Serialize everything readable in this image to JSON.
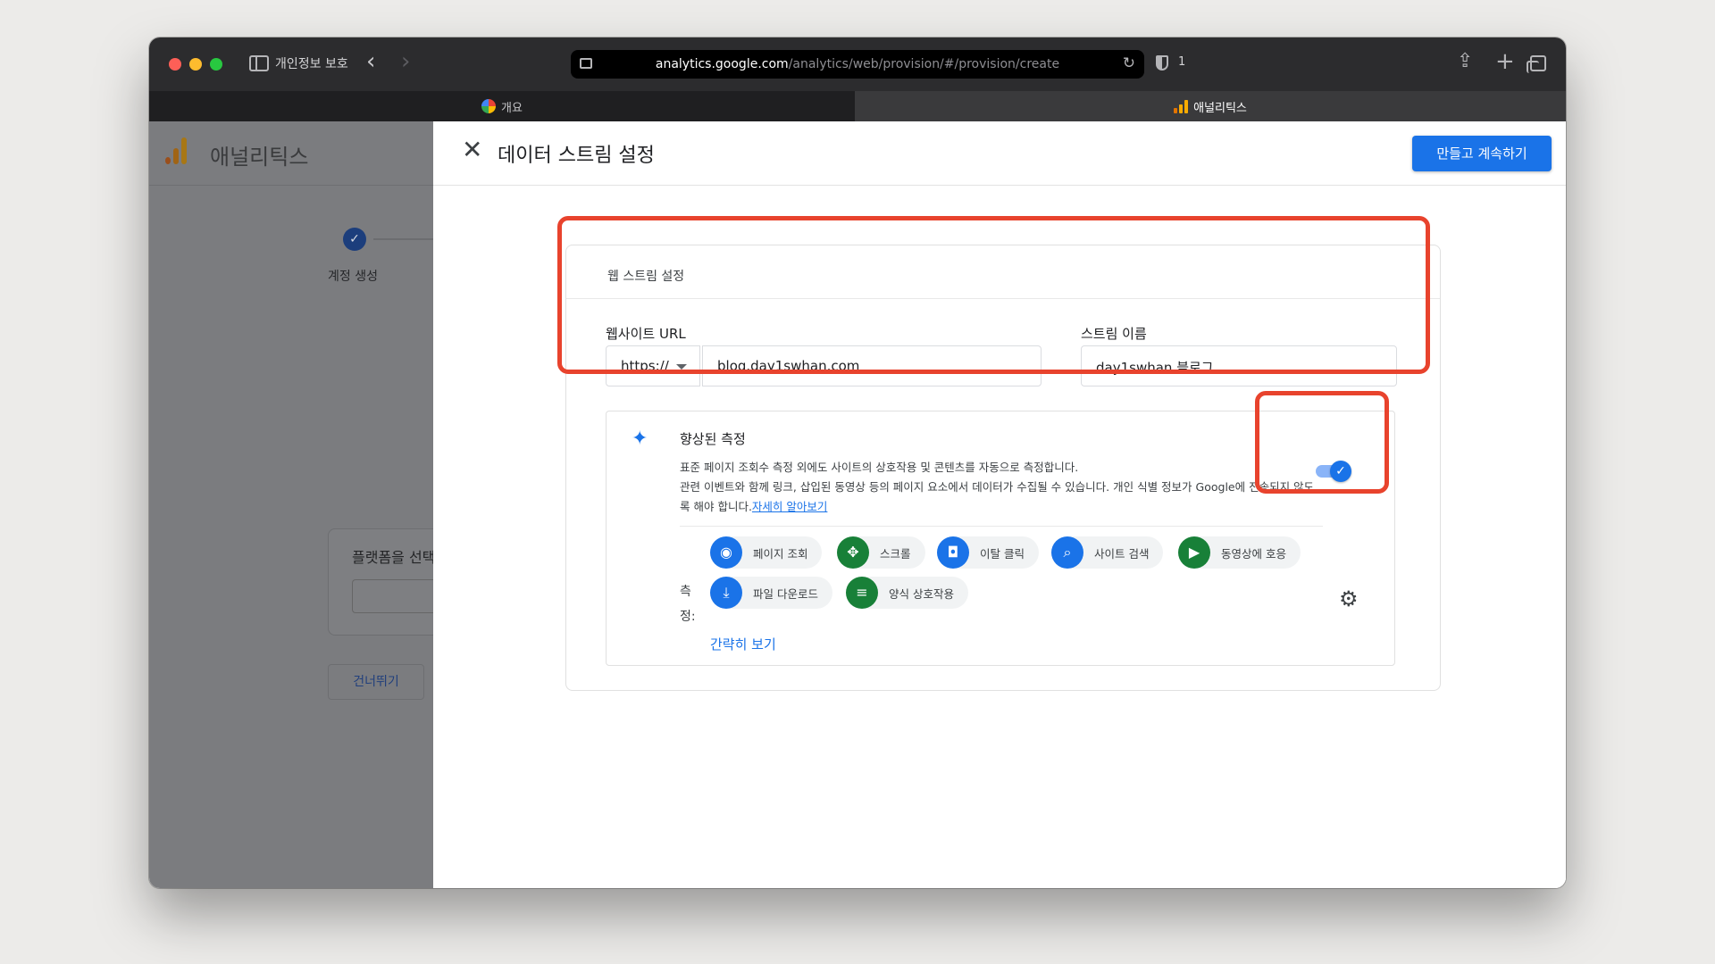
{
  "browser": {
    "privacy_label": "개인정보 보호",
    "url_host": "analytics.google.com",
    "url_path": "/analytics/web/provision/#/provision/create",
    "shield_count": "1",
    "tabs": [
      {
        "label": "개요",
        "icon": "google-icon"
      },
      {
        "label": "애널리틱스",
        "icon": "analytics-icon"
      }
    ]
  },
  "background_page": {
    "app_title": "애널리틱스",
    "step_label": "계정 생성",
    "platform_heading": "플랫폼을 선택",
    "skip_button": "건너뛰기"
  },
  "dialog": {
    "title": "데이터 스트림 설정",
    "primary_button": "만들고 계속하기",
    "section_title": "웹 스트림 설정",
    "website_url_label": "웹사이트 URL",
    "scheme_value": "https://",
    "url_value": "blog.day1swhan.com",
    "stream_name_label": "스트림 이름",
    "stream_name_value": "day1swhan 블로그",
    "enhanced": {
      "title": "향상된 측정",
      "desc_line1": "표준 페이지 조회수 측정 외에도 사이트의 상호작용 및 콘텐츠를 자동으로 측정합니다.",
      "desc_line2": "관련 이벤트와 함께 링크, 삽입된 동영상 등의 페이지 요소에서 데이터가 수집될 수 있습니다. 개인 식별 정보가 Google에 전송되지 않도록 해야 합니다.",
      "learn_more": "자세히 알아보기",
      "toggle_on": true,
      "measure_label": "측정:",
      "chips": [
        {
          "label": "페이지 조회",
          "icon": "eye-icon",
          "color": "#1a73e8"
        },
        {
          "label": "스크롤",
          "icon": "scroll-icon",
          "color": "#188038"
        },
        {
          "label": "이탈 클릭",
          "icon": "mouse-icon",
          "color": "#1a73e8"
        },
        {
          "label": "사이트 검색",
          "icon": "search-icon",
          "color": "#1a73e8"
        },
        {
          "label": "동영상에 호응",
          "icon": "play-icon",
          "color": "#188038"
        },
        {
          "label": "파일 다운로드",
          "icon": "download-icon",
          "color": "#1a73e8"
        },
        {
          "label": "양식 상호작용",
          "icon": "form-icon",
          "color": "#188038"
        }
      ],
      "collapse_link": "간략히 보기"
    }
  },
  "colors": {
    "accent": "#1a73e8",
    "highlight": "#e8432d"
  }
}
